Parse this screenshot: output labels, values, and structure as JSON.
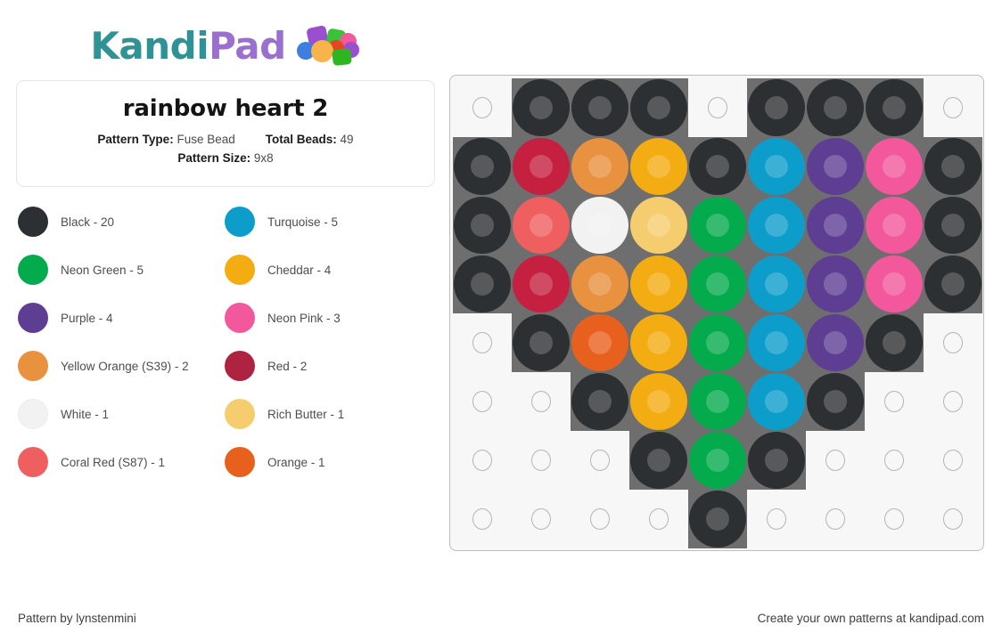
{
  "brand": {
    "name_part1": "Kandi",
    "name_part2": "Pad",
    "color_teal": "#2f9395",
    "color_purple": "#9a6fd0",
    "logo_icon": "bead-pile-icon"
  },
  "info": {
    "title": "rainbow heart 2",
    "pattern_type_label": "Pattern Type:",
    "pattern_type_value": "Fuse Bead",
    "total_beads_label": "Total Beads:",
    "total_beads_value": "49",
    "pattern_size_label": "Pattern Size:",
    "pattern_size_value": "9x8"
  },
  "legend": [
    {
      "name": "Black - 20",
      "color": "#2d3033"
    },
    {
      "name": "Turquoise - 5",
      "color": "#0d9dcb"
    },
    {
      "name": "Neon Green - 5",
      "color": "#04ab4d"
    },
    {
      "name": "Cheddar - 4",
      "color": "#f3ac11"
    },
    {
      "name": "Purple - 4",
      "color": "#5e3e93"
    },
    {
      "name": "Neon Pink - 3",
      "color": "#f2589b"
    },
    {
      "name": "Yellow Orange (S39) - 2",
      "color": "#e8913f"
    },
    {
      "name": "Red - 2",
      "color": "#ae2340"
    },
    {
      "name": "White - 1",
      "color": "#f2f2f2"
    },
    {
      "name": "Rich Butter - 1",
      "color": "#f5cd6e"
    },
    {
      "name": "Coral Red (S87) - 1",
      "color": "#ef5f5f"
    },
    {
      "name": "Orange - 1",
      "color": "#e8601d"
    }
  ],
  "palette": {
    "black": "#2d3033",
    "turquoise": "#0d9dcb",
    "neon_green": "#04ab4d",
    "cheddar": "#f3ac11",
    "purple": "#5e3e93",
    "neon_pink": "#f2589b",
    "yellow_orange": "#e8913f",
    "red": "#c5203f",
    "white": "#f2f2f2",
    "rich_butter": "#f5cd6e",
    "coral_red": "#ef5f5f",
    "orange": "#e8601d",
    "empty": null
  },
  "grid": {
    "columns": 9,
    "rows": 8,
    "cells": [
      [
        null,
        "black",
        "black",
        "black",
        null,
        "black",
        "black",
        "black",
        null
      ],
      [
        "black",
        "red",
        "yellow_orange",
        "cheddar",
        "black",
        "turquoise",
        "purple",
        "neon_pink",
        "black"
      ],
      [
        "black",
        "coral_red",
        "white",
        "rich_butter",
        "neon_green",
        "turquoise",
        "purple",
        "neon_pink",
        "black"
      ],
      [
        "black",
        "red",
        "yellow_orange",
        "cheddar",
        "neon_green",
        "turquoise",
        "purple",
        "neon_pink",
        "black"
      ],
      [
        null,
        "black",
        "orange",
        "cheddar",
        "neon_green",
        "turquoise",
        "purple",
        "black",
        null
      ],
      [
        null,
        null,
        "black",
        "cheddar",
        "neon_green",
        "turquoise",
        "black",
        null,
        null
      ],
      [
        null,
        null,
        null,
        "black",
        "neon_green",
        "black",
        null,
        null,
        null
      ],
      [
        null,
        null,
        null,
        null,
        "black",
        null,
        null,
        null,
        null
      ]
    ]
  },
  "footer": {
    "left": "Pattern by lynstenmini",
    "right": "Create your own patterns at kandipad.com"
  }
}
